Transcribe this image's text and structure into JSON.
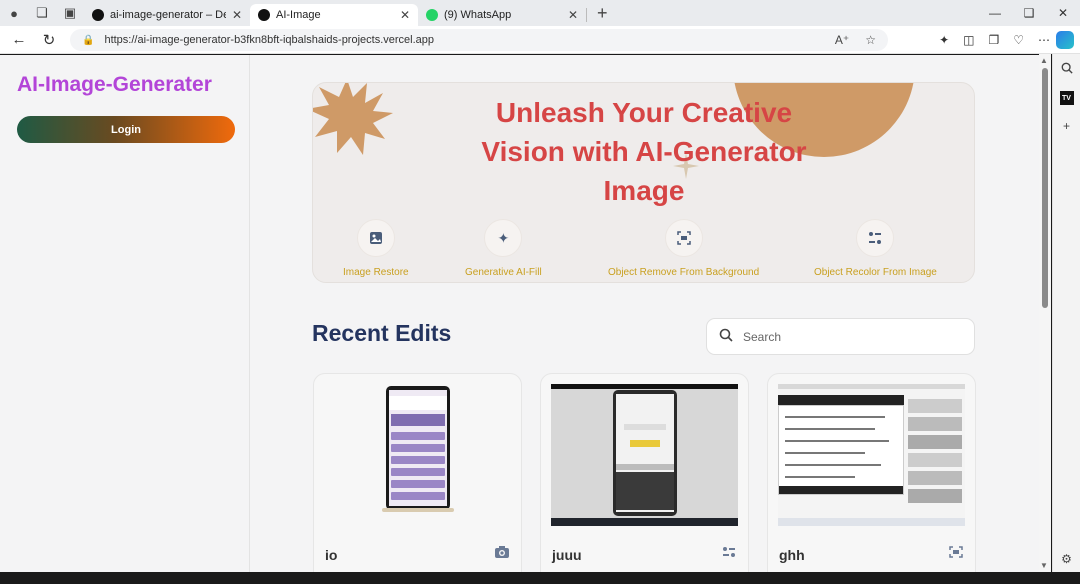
{
  "browser": {
    "tabs": [
      {
        "title": "ai-image-generator – Deploymen",
        "active": false,
        "favicon": "vercel-icon"
      },
      {
        "title": "AI-Image",
        "active": true,
        "favicon": "vercel-icon"
      },
      {
        "title": "(9) WhatsApp",
        "active": false,
        "favicon": "whatsapp-icon"
      }
    ],
    "url": "https://ai-image-generator-b3fkn8bft-iqbalshaids-projects.vercel.app"
  },
  "sidebar": {
    "brand": "AI-Image-Generater",
    "login_label": "Login"
  },
  "hero": {
    "headline": "Unleash Your Creative Vision with AI-Generator Image",
    "features": [
      {
        "label": "Image Restore",
        "icon": "image-icon"
      },
      {
        "label": "Generative AI-Fill",
        "icon": "sparkles-icon"
      },
      {
        "label": "Object Remove From Background",
        "icon": "scan-icon"
      },
      {
        "label": "Object Recolor From Image",
        "icon": "sliders-icon"
      }
    ]
  },
  "recent": {
    "heading": "Recent Edits",
    "search_placeholder": "Search",
    "items": [
      {
        "name": "io",
        "icon": "camera-icon"
      },
      {
        "name": "juuu",
        "icon": "sliders-icon"
      },
      {
        "name": "ghh",
        "icon": "scan-icon"
      }
    ]
  },
  "colors": {
    "brand": "#b345d8",
    "headline": "#d64545",
    "feature_label": "#c9a020",
    "heading": "#24345f",
    "hero_accent": "#cf9a67"
  }
}
